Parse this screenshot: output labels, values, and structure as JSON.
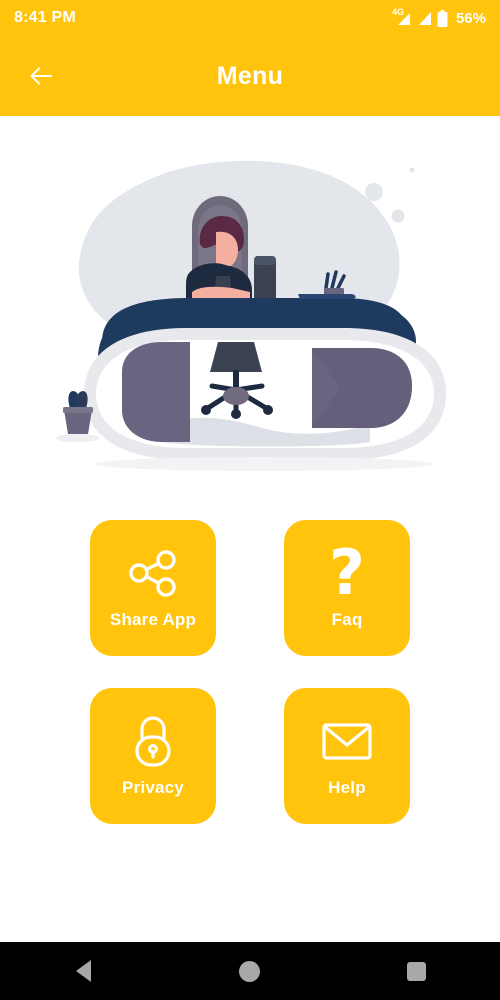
{
  "status_bar": {
    "time": "8:41 PM",
    "network_label": "4G",
    "battery_percent": "56%",
    "icons": [
      "signal-4g-icon",
      "signal-bars-icon",
      "battery-icon"
    ]
  },
  "app_bar": {
    "title": "Menu",
    "back_icon": "arrow-left-icon"
  },
  "illustration": {
    "name": "person-working-at-desk-illustration",
    "colors": {
      "blob": "#E3E6EA",
      "desk_top": "#1F3A5F",
      "desk_side": "#6B6480",
      "desk_rim": "#E8E9ED",
      "chair": "#6F6B7D",
      "hair": "#5A2A44",
      "skin": "#F5AFA1",
      "jacket": "#1D2A40",
      "cup": "#3B4252",
      "plant_pot": "#6B6480",
      "plant_leaf": "#1F3A5F"
    }
  },
  "menu": {
    "items": [
      {
        "label": "Share App",
        "icon": "share-icon",
        "color": "#FFC40B"
      },
      {
        "label": "Faq",
        "icon": "question-mark-icon",
        "color": "#FFC40B"
      },
      {
        "label": "Privacy",
        "icon": "lock-icon",
        "color": "#FFC40B"
      },
      {
        "label": "Help",
        "icon": "envelope-icon",
        "color": "#FFC40B"
      }
    ]
  },
  "navigation_bar": {
    "buttons": [
      {
        "name": "back",
        "icon": "triangle-back-icon"
      },
      {
        "name": "home",
        "icon": "circle-home-icon"
      },
      {
        "name": "recents",
        "icon": "square-recents-icon"
      }
    ]
  },
  "theme": {
    "primary": "#FFC40B",
    "on_primary": "#FFFFFF",
    "background": "#FFFFFF",
    "nav_bar": "#000000"
  }
}
